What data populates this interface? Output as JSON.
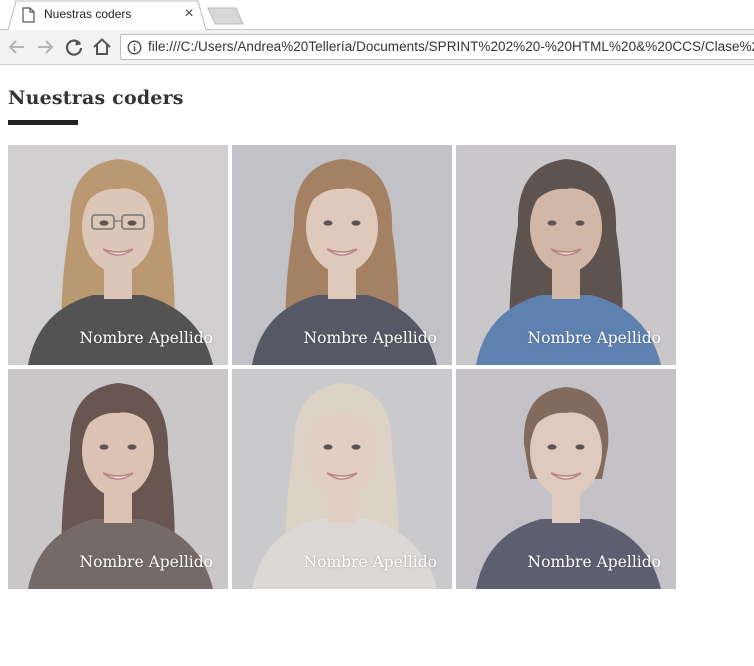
{
  "browser": {
    "tab_title": "Nuestras coders",
    "url": "file:///C:/Users/Andrea%20Tellería/Documents/SPRINT%202%20-%20HTML%20&%20CCS/Clase%2"
  },
  "page": {
    "title": "Nuestras coders",
    "accent_color": "#222222"
  },
  "coders": [
    {
      "name": "Nombre Apellido",
      "hair": "#b98a52",
      "top": "#2a2a2a",
      "bg": "#d9d6d6",
      "skin": "#e8c9b4",
      "glasses": true
    },
    {
      "name": "Nombre Apellido",
      "hair": "#9b6a40",
      "top": "#2f3142",
      "bg": "#c4c2c8",
      "skin": "#ebcdb8",
      "glasses": false
    },
    {
      "name": "Nombre Apellido",
      "hair": "#3a2a22",
      "top": "#3a6aa8",
      "bg": "#cdcbcd",
      "skin": "#d9b59c",
      "glasses": false
    },
    {
      "name": "Nombre Apellido",
      "hair": "#4a2e26",
      "top": "#5a4a44",
      "bg": "#cfcbcc",
      "skin": "#e6c4ad",
      "glasses": false
    },
    {
      "name": "Nombre Apellido",
      "hair": "#e8dcc8",
      "top": "#e6e2de",
      "bg": "#cfcdd0",
      "skin": "#efd6c4",
      "glasses": false
    },
    {
      "name": "Nombre Apellido",
      "hair": "#6b4a36",
      "top": "#3a3a52",
      "bg": "#c6c4c8",
      "skin": "#ecd0bc",
      "glasses": false
    }
  ]
}
